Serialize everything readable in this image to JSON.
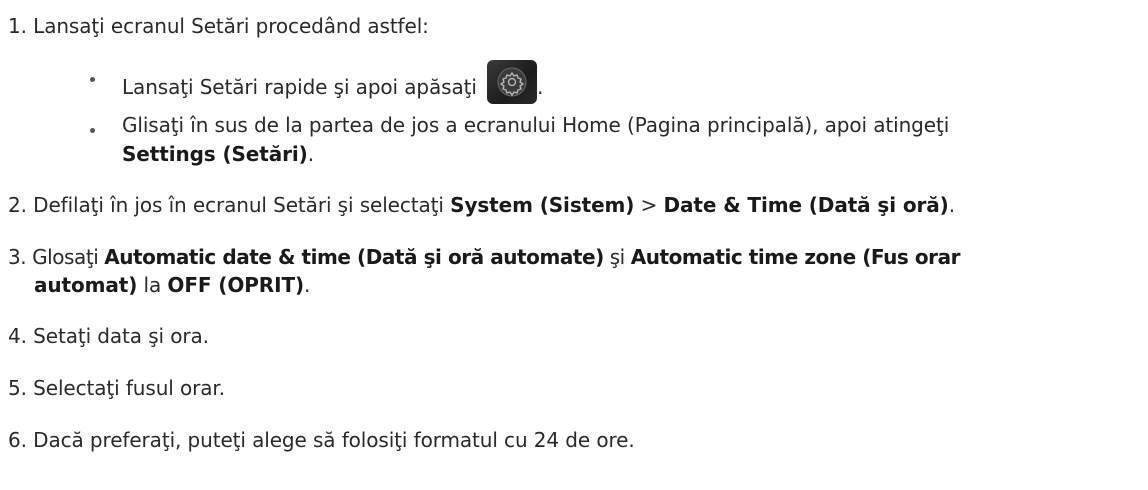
{
  "steps": [
    {
      "num": "1.",
      "text": "Lansaţi ecranul Setări procedând astfel:"
    },
    {
      "num": "2.",
      "pre": "Defilaţi în jos în ecranul Setări şi selectaţi ",
      "b1": "System (Sistem)",
      "mid": " > ",
      "b2": "Date & Time (Dată şi oră)",
      "post": "."
    },
    {
      "num": "3.",
      "pre": "Glosaţi ",
      "b1": "Automatic date & time (Dată şi oră automate)",
      "mid": " şi ",
      "b2": "Automatic time zone (Fus orar",
      "b3": "automat)",
      "mid2": " la ",
      "b4": "OFF (OPRIT)",
      "post": "."
    },
    {
      "num": "4.",
      "text": "Setaţi data şi ora."
    },
    {
      "num": "5.",
      "text": "Selectaţi fusul orar."
    },
    {
      "num": "6.",
      "text": "Dacă preferaţi, puteţi alege să folosiţi formatul cu 24 de ore."
    }
  ],
  "sub_bullets": [
    {
      "pre": "Lansaţi Setări rapide şi apoi apăsaţi ",
      "icon": "settings-gear-icon",
      "post": "."
    },
    {
      "line1": "Glisaţi în sus de la partea de jos a ecranului Home (Pagina principală), apoi atingeţi",
      "b": "Settings (Setări)",
      "post": "."
    }
  ]
}
